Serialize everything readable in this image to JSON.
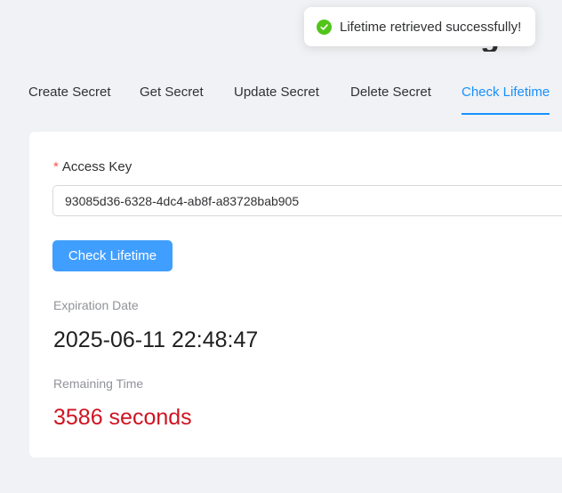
{
  "header": {
    "title_fragment": "g"
  },
  "toast": {
    "message": "Lifetime retrieved successfully!",
    "icon": "check-circle-icon",
    "status_color": "#52c41a"
  },
  "tabs": [
    {
      "label": "Create Secret",
      "active": false
    },
    {
      "label": "Get Secret",
      "active": false
    },
    {
      "label": "Update Secret",
      "active": false
    },
    {
      "label": "Delete Secret",
      "active": false
    },
    {
      "label": "Check Lifetime",
      "active": true
    }
  ],
  "form": {
    "required_marker": "*",
    "access_key_label": "Access Key",
    "access_key_value": "93085d36-6328-4dc4-ab8f-a83728bab905",
    "check_button_label": "Check Lifetime"
  },
  "result": {
    "expiration_label": "Expiration Date",
    "expiration_value": "2025-06-11 22:48:47",
    "remaining_label": "Remaining Time",
    "remaining_value": "3586 seconds"
  },
  "colors": {
    "accent": "#1890ff",
    "button": "#409eff",
    "remaining_text": "#cf1322",
    "background": "#f0f2f5"
  }
}
